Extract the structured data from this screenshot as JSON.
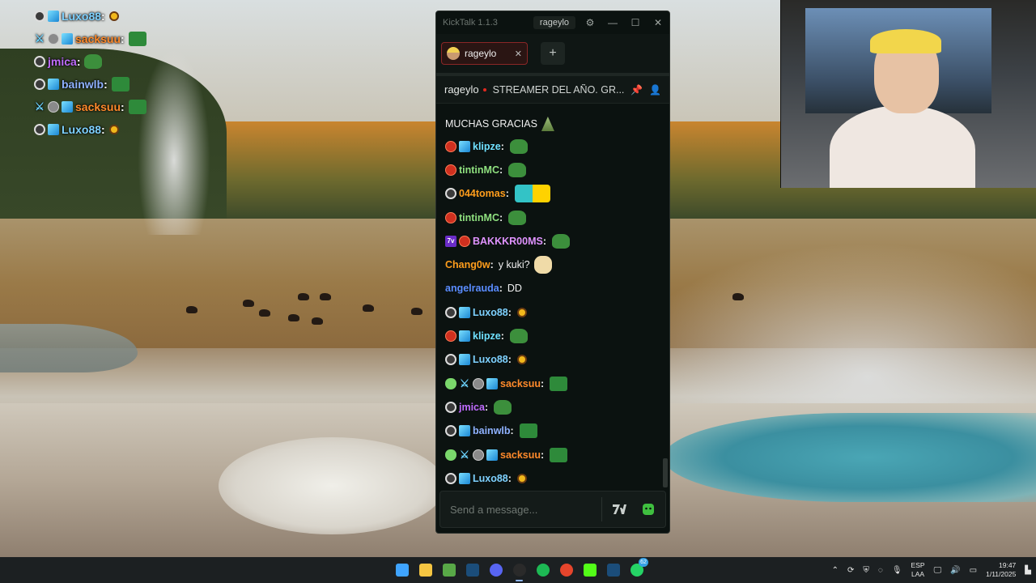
{
  "overlay_chat": [
    {
      "badges": [
        "circle",
        "cube"
      ],
      "user": "Luxo88",
      "color": "#7ed1ff",
      "emote": "small"
    },
    {
      "badges": [
        "sword",
        "grey",
        "cube"
      ],
      "user": "sacksuu",
      "color": "#ff8a2b",
      "emote": "box"
    },
    {
      "badges": [
        "circle"
      ],
      "user": "jmica",
      "color": "#c06cff",
      "emote": "frog"
    },
    {
      "badges": [
        "circle",
        "cube"
      ],
      "user": "bainwlb",
      "color": "#8fb2ff",
      "emote": "box"
    },
    {
      "badges": [
        "sword",
        "grey",
        "cube"
      ],
      "user": "sacksuu",
      "color": "#ff8a2b",
      "emote": "box"
    },
    {
      "badges": [
        "circle",
        "cube"
      ],
      "user": "Luxo88",
      "color": "#7ed1ff",
      "emote": "small"
    }
  ],
  "window": {
    "app_title": "KickTalk 1.1.3",
    "user": "rageylo",
    "tab_label": "rageylo",
    "add_tab": "+",
    "channel_name": "rageylo",
    "channel_title": "STREAMER DEL AÑO. GR...",
    "composer_placeholder": "Send a message...",
    "first_line": "MUCHAS GRACIAS"
  },
  "messages": [
    {
      "badges": [
        "red",
        "cube"
      ],
      "user": "klipze",
      "color": "#6fe0ff",
      "text": "",
      "emote": "frog"
    },
    {
      "badges": [
        "red"
      ],
      "user": "tintinMC",
      "color": "#8fe07f",
      "text": "",
      "emote": "frog"
    },
    {
      "badges": [
        "circle"
      ],
      "user": "044tomas",
      "color": "#ff9d1c",
      "text": "",
      "emote": "yellow"
    },
    {
      "badges": [
        "red"
      ],
      "user": "tintinMC",
      "color": "#8fe07f",
      "text": "",
      "emote": "frog"
    },
    {
      "badges": [
        "7tv",
        "red"
      ],
      "user": "BAKKKR00MS",
      "color": "#e093ff",
      "text": "",
      "emote": "frog"
    },
    {
      "badges": [],
      "user": "Chang0w",
      "color": "#ff9d1c",
      "text": "y kuki?",
      "emote": "babe"
    },
    {
      "badges": [],
      "user": "angelrauda",
      "color": "#5a8cff",
      "text": "DD",
      "emote": ""
    },
    {
      "badges": [
        "circle",
        "cube"
      ],
      "user": "Luxo88",
      "color": "#7ed1ff",
      "text": "",
      "emote": "small"
    },
    {
      "badges": [
        "red",
        "cube"
      ],
      "user": "klipze",
      "color": "#6fe0ff",
      "text": "",
      "emote": "frog"
    },
    {
      "badges": [
        "circle",
        "cube"
      ],
      "user": "Luxo88",
      "color": "#7ed1ff",
      "text": "",
      "emote": "small"
    },
    {
      "badges": [
        "alien",
        "sword",
        "grey",
        "cube"
      ],
      "user": "sacksuu",
      "color": "#ff8a2b",
      "text": "",
      "emote": "box"
    },
    {
      "badges": [
        "circle"
      ],
      "user": "jmica",
      "color": "#c06cff",
      "text": "",
      "emote": "frog"
    },
    {
      "badges": [
        "circle",
        "cube"
      ],
      "user": "bainwlb",
      "color": "#8fb2ff",
      "text": "",
      "emote": "box"
    },
    {
      "badges": [
        "alien",
        "sword",
        "grey",
        "cube"
      ],
      "user": "sacksuu",
      "color": "#ff8a2b",
      "text": "",
      "emote": "box"
    },
    {
      "badges": [
        "circle",
        "cube"
      ],
      "user": "Luxo88",
      "color": "#7ed1ff",
      "text": "",
      "emote": "small"
    }
  ],
  "taskbar": {
    "apps": [
      {
        "name": "windows-start",
        "color": "#3fa4ff"
      },
      {
        "name": "file-explorer",
        "color": "#f5c542"
      },
      {
        "name": "app-green",
        "color": "#58a847"
      },
      {
        "name": "steam",
        "color": "#1b4d7a"
      },
      {
        "name": "discord",
        "color": "#5865f2"
      },
      {
        "name": "obs",
        "color": "#2a2a2a"
      },
      {
        "name": "spotify",
        "color": "#1db954"
      },
      {
        "name": "chrome",
        "color": "#e6452c"
      },
      {
        "name": "kick",
        "color": "#53fc18"
      },
      {
        "name": "steam-2",
        "color": "#1b4d7a"
      },
      {
        "name": "whatsapp",
        "color": "#25d366"
      }
    ],
    "whatsapp_badge": "62",
    "lang_top": "ESP",
    "lang_bottom": "LAA",
    "time": "19:47",
    "date": "1/11/2025"
  }
}
